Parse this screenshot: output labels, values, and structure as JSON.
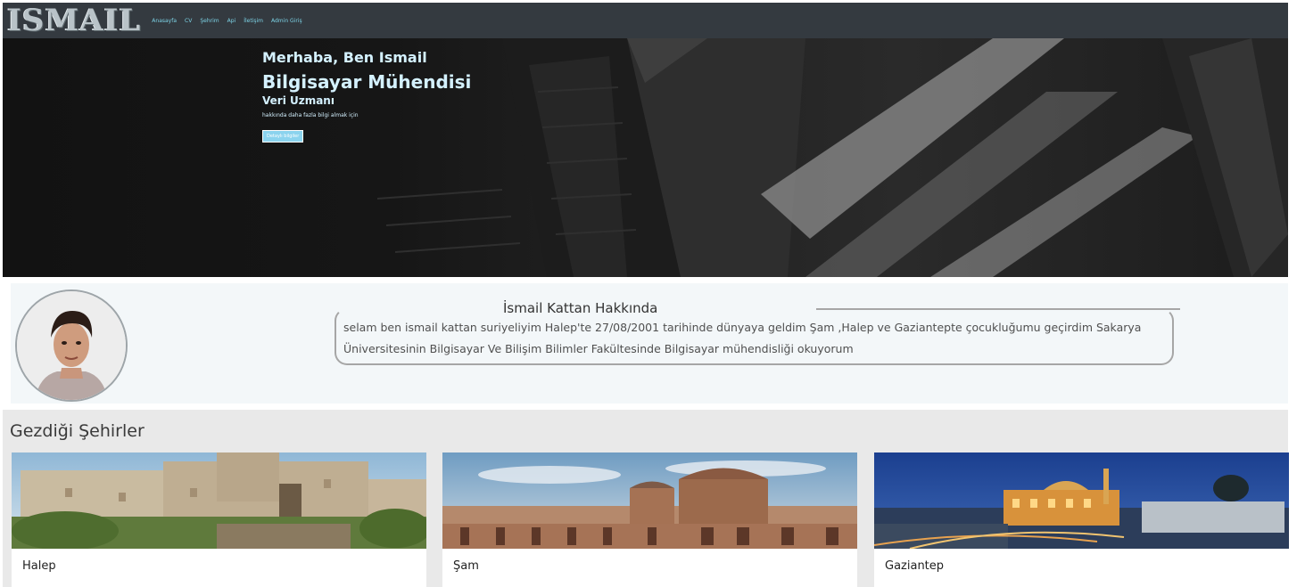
{
  "nav": {
    "logo": "ISMAIL",
    "links": [
      "Anasayfa",
      "CV",
      "Şehrim",
      "Api",
      "İletişim",
      "Admin Giriş"
    ]
  },
  "hero": {
    "greeting": "Merhaba, Ben Ismail",
    "title": "Bilgisayar Mühendisi",
    "subtitle": "Veri Uzmanı",
    "small_text": "hakkında daha fazla bilgi almak için",
    "button_label": "Detaylı bilgiler"
  },
  "about": {
    "title": "İsmail Kattan Hakkında",
    "text": "selam ben ismail kattan suriyeliyim Halep'te 27/08/2001 tarihinde dünyaya geldim Şam ,Halep ve Gaziantepte çocukluğumu geçirdim Sakarya Üniversitesinin Bilgisayar Ve Bilişim Bilimler Fakültesinde Bilgisayar mühendisliği okuyorum"
  },
  "cities": {
    "title": "Gezdiği Şehirler",
    "items": [
      "Halep",
      "Şam",
      "Gaziantep"
    ]
  },
  "colors": {
    "navbar": "#343a40",
    "nav_link": "#7dd3e6",
    "hero_text": "#d4f1ff",
    "button": "#8bd3ee"
  }
}
